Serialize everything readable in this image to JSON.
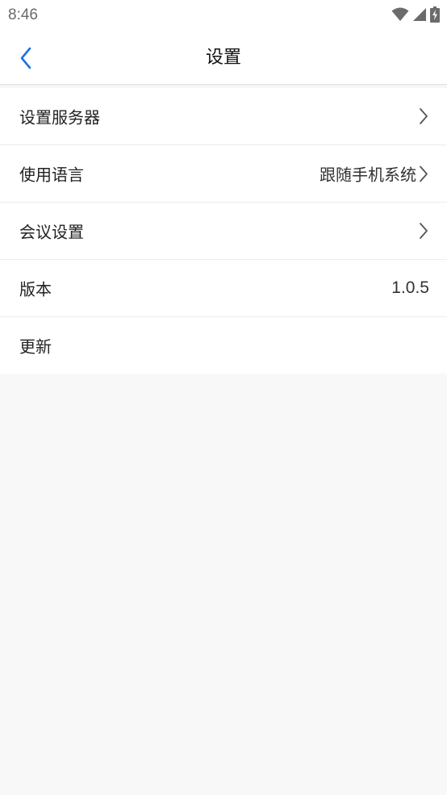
{
  "status_bar": {
    "time": "8:46",
    "icons": [
      "wifi-icon",
      "cellular-signal-icon",
      "battery-charging-icon"
    ]
  },
  "header": {
    "back_icon": "chevron-left-icon",
    "title": "设置"
  },
  "settings": {
    "items": [
      {
        "label": "设置服务器",
        "value": "",
        "icon": "chevron-right-icon"
      },
      {
        "label": "使用语言",
        "value": "跟随手机系统",
        "icon": "chevron-right-icon"
      },
      {
        "label": "会议设置",
        "value": "",
        "icon": "chevron-right-icon"
      },
      {
        "label": "版本",
        "value": "1.0.5"
      },
      {
        "label": "更新",
        "value": ""
      }
    ]
  },
  "colors": {
    "accent": "#1a73e8",
    "background": "#f8f8f8",
    "surface": "#ffffff",
    "divider": "#ececec"
  }
}
